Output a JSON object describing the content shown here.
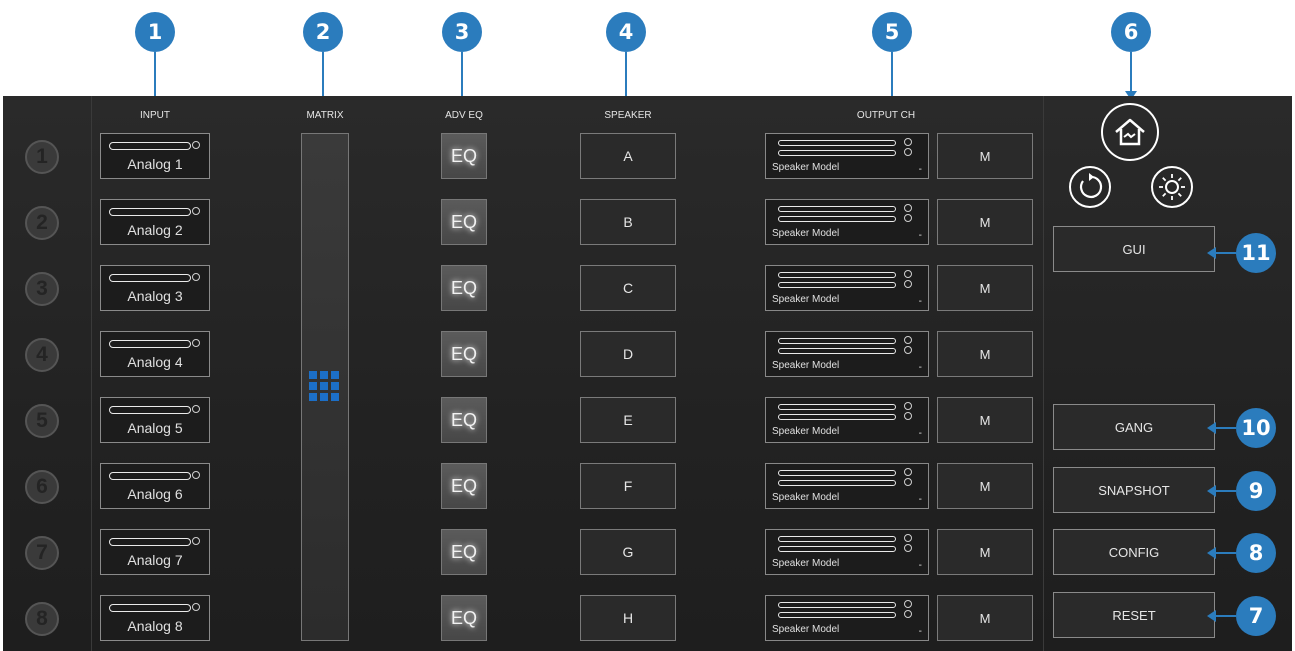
{
  "callouts": [
    "1",
    "2",
    "3",
    "4",
    "5",
    "6",
    "7",
    "8",
    "9",
    "10",
    "11"
  ],
  "headers": {
    "input": "INPUT",
    "matrix": "MATRIX",
    "adv_eq": "ADV EQ",
    "speaker": "SPEAKER",
    "output_ch": "OUTPUT CH"
  },
  "channels": [
    {
      "number": "1",
      "input": "Analog 1",
      "eq": "EQ",
      "speaker": "A",
      "output_model": "Speaker Model",
      "output_dash": "-",
      "mute": "M"
    },
    {
      "number": "2",
      "input": "Analog 2",
      "eq": "EQ",
      "speaker": "B",
      "output_model": "Speaker Model",
      "output_dash": "-",
      "mute": "M"
    },
    {
      "number": "3",
      "input": "Analog 3",
      "eq": "EQ",
      "speaker": "C",
      "output_model": "Speaker Model",
      "output_dash": "-",
      "mute": "M"
    },
    {
      "number": "4",
      "input": "Analog 4",
      "eq": "EQ",
      "speaker": "D",
      "output_model": "Speaker Model",
      "output_dash": "-",
      "mute": "M"
    },
    {
      "number": "5",
      "input": "Analog 5",
      "eq": "EQ",
      "speaker": "E",
      "output_model": "Speaker Model",
      "output_dash": "-",
      "mute": "M"
    },
    {
      "number": "6",
      "input": "Analog 6",
      "eq": "EQ",
      "speaker": "F",
      "output_model": "Speaker Model",
      "output_dash": "-",
      "mute": "M"
    },
    {
      "number": "7",
      "input": "Analog 7",
      "eq": "EQ",
      "speaker": "G",
      "output_model": "Speaker Model",
      "output_dash": "-",
      "mute": "M"
    },
    {
      "number": "8",
      "input": "Analog 8",
      "eq": "EQ",
      "speaker": "H",
      "output_model": "Speaker Model",
      "output_dash": "-",
      "mute": "M"
    }
  ],
  "right_panel": {
    "gui": "GUI",
    "gang": "GANG",
    "snapshot": "SNAPSHOT",
    "config": "CONFIG",
    "reset": "RESET"
  },
  "icons": {
    "home": "home-icon",
    "refresh": "refresh-icon",
    "brightness": "brightness-icon"
  },
  "colors": {
    "accent": "#2b7cbd",
    "matrix_grid": "#1c6fc7",
    "panel_bg": "#222222"
  }
}
